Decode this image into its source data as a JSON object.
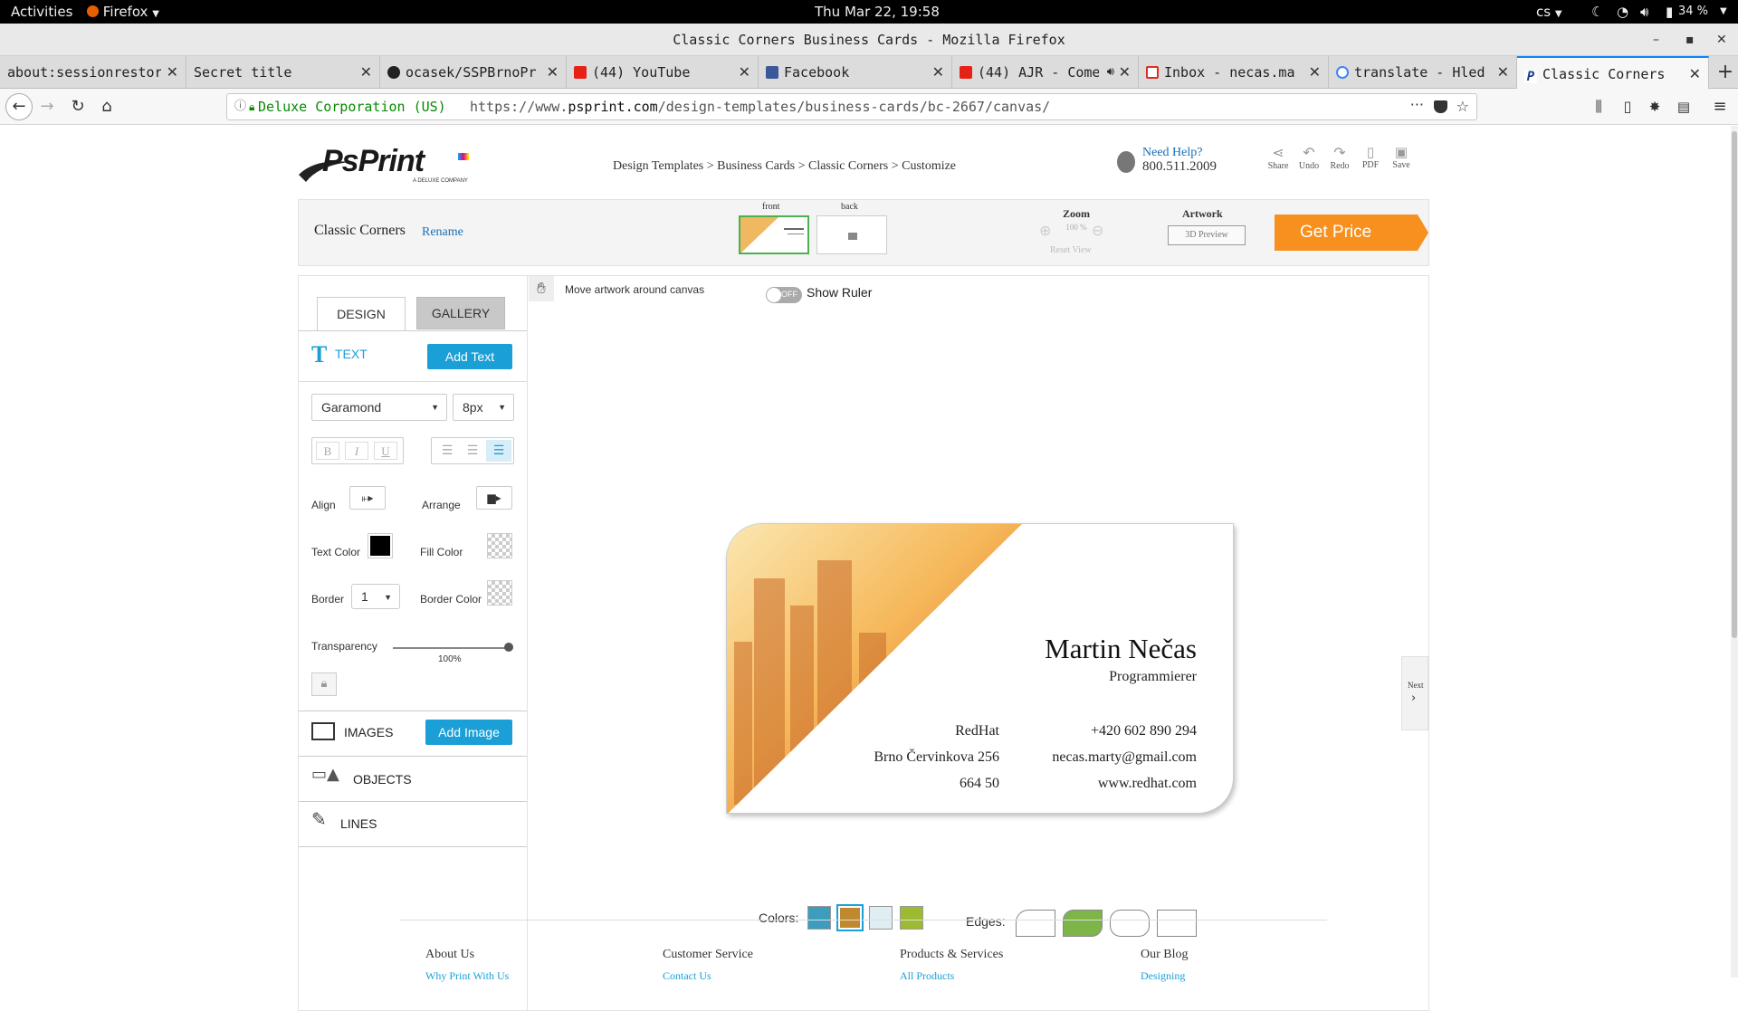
{
  "topbar": {
    "activities": "Activities",
    "app": "Firefox",
    "clock": "Thu Mar 22, 19:58",
    "lang": "cs",
    "battery": "34 %"
  },
  "window": {
    "title": "Classic Corners Business Cards - Mozilla Firefox"
  },
  "tabs": [
    {
      "label": "about:sessionrestor",
      "icon": "page-icon"
    },
    {
      "label": "Secret title",
      "icon": "none"
    },
    {
      "label": "ocasek/SSPBrnoPr",
      "icon": "github-icon"
    },
    {
      "label": "(44) YouTube",
      "icon": "youtube-icon"
    },
    {
      "label": "Facebook",
      "icon": "facebook-icon"
    },
    {
      "label": "(44) AJR - Come",
      "icon": "youtube-icon"
    },
    {
      "label": "Inbox - necas.ma",
      "icon": "gmail-icon"
    },
    {
      "label": "translate - Hled",
      "icon": "google-icon"
    },
    {
      "label": "Classic Corners",
      "icon": "psprint-icon"
    }
  ],
  "navbar": {
    "security_label": "Deluxe Corporation (US)",
    "url_prefix": "https://www.",
    "url_domain": "psprint.com",
    "url_path": "/design-templates/business-cards/bc-2667/canvas/"
  },
  "header": {
    "logo_text": "PsPrint",
    "logo_sub": "A DELUXE COMPANY",
    "breadcrumb": "Design Templates > Business Cards > Classic Corners > Customize",
    "help_label": "Need Help?",
    "help_phone": "800.511.2009",
    "actions": [
      "Share",
      "Undo",
      "Redo",
      "PDF",
      "Save"
    ]
  },
  "toolbar": {
    "design_name": "Classic Corners",
    "rename": "Rename",
    "front_label": "front",
    "back_label": "back",
    "zoom_label": "Zoom",
    "zoom_value": "100 %",
    "reset_view": "Reset View",
    "artwork_label": "Artwork",
    "preview_3d": "3D Preview",
    "get_price": "Get Price"
  },
  "panel": {
    "tab_design": "DESIGN",
    "tab_gallery": "GALLERY",
    "text_section": "TEXT",
    "add_text": "Add Text",
    "font": "Garamond",
    "size": "8px",
    "bold": "B",
    "italic": "I",
    "underline": "U",
    "align_label": "Align",
    "arrange_label": "Arrange",
    "text_color_label": "Text Color",
    "fill_color_label": "Fill Color",
    "border_label": "Border",
    "border_value": "1",
    "border_color_label": "Border Color",
    "transparency_label": "Transparency",
    "transparency_value": "100%",
    "images_section": "IMAGES",
    "add_image": "Add Image",
    "objects_section": "OBJECTS",
    "lines_section": "LINES"
  },
  "canvas": {
    "move_hint": "Move artwork around canvas",
    "toggle_state": "OFF",
    "show_ruler": "Show Ruler",
    "next": "Next",
    "colors_label": "Colors:",
    "edges_label": "Edges:",
    "swatches": [
      "#3c9dbf",
      "#c0892e",
      "#dfeef3",
      "#9dbb30"
    ],
    "edge_selected_color": "#7db548"
  },
  "card": {
    "name": "Martin Nečas",
    "title": "Programmierer",
    "company": "RedHat",
    "street": "Brno Červinkova 256",
    "zip": "664 50",
    "phone": "+420 602 890 294",
    "email": "necas.marty@gmail.com",
    "web": "www.redhat.com"
  },
  "footer": {
    "cols": [
      "About Us",
      "Customer Service",
      "Products & Services",
      "Our Blog"
    ],
    "links": [
      "Why Print With Us",
      "Contact Us",
      "All Products",
      "Designing"
    ]
  }
}
